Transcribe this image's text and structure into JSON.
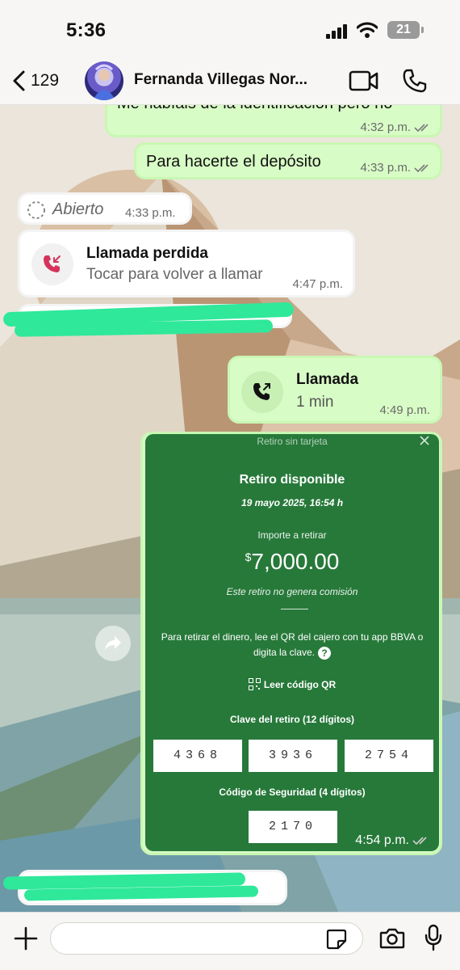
{
  "status_bar": {
    "time": "5:36",
    "battery": "21",
    "signal_icon": "signal-icon",
    "wifi_icon": "wifi-icon"
  },
  "header": {
    "back_count": "129",
    "contact_name": "Fernanda Villegas Nor...",
    "back_icon": "chevron-left-icon",
    "video_icon": "video-icon",
    "phone_icon": "phone-icon"
  },
  "messages": [
    {
      "direction": "out",
      "text": "Me habíais de la identificación pero no",
      "time": "4:32 p.m.",
      "read": true
    },
    {
      "direction": "out",
      "text": "Para hacerte el depósito",
      "time": "4:33 p.m.",
      "read": true
    },
    {
      "direction": "in",
      "type": "status",
      "text": "Abierto",
      "time": "4:33 p.m."
    },
    {
      "direction": "in",
      "type": "missed_call",
      "title": "Llamada perdida",
      "subtitle": "Tocar para volver a llamar",
      "time": "4:47 p.m."
    },
    {
      "direction": "out",
      "type": "call",
      "title": "Llamada",
      "subtitle": "1 min",
      "time": "4:49 p.m."
    },
    {
      "direction": "out",
      "type": "image",
      "time": "4:54 p.m.",
      "read": true,
      "card": {
        "top_title": "Retiro sin tarjeta",
        "title": "Retiro disponible",
        "date": "19 mayo 2025, 16:54 h",
        "amount_label": "Importe a retirar",
        "currency": "$",
        "amount": "7,000.00",
        "no_fee": "Este retiro no genera comisión",
        "instructions": "Para retirar el dinero, lee el QR del cajero con tu app BBVA o digita la clave.",
        "qr_label": "Leer código QR",
        "code_label": "Clave del retiro (12 dígitos)",
        "codes": [
          "4368",
          "3936",
          "2754"
        ],
        "security_label": "Código de Seguridad (4 dígitos)",
        "security_code": "2170"
      }
    }
  ],
  "input": {
    "placeholder": ""
  },
  "colors": {
    "outgoing": "#d8fcc6",
    "incoming": "#ffffff",
    "bbva_green": "#27793a",
    "redaction": "#2fe89a",
    "missed": "#d6335c"
  }
}
